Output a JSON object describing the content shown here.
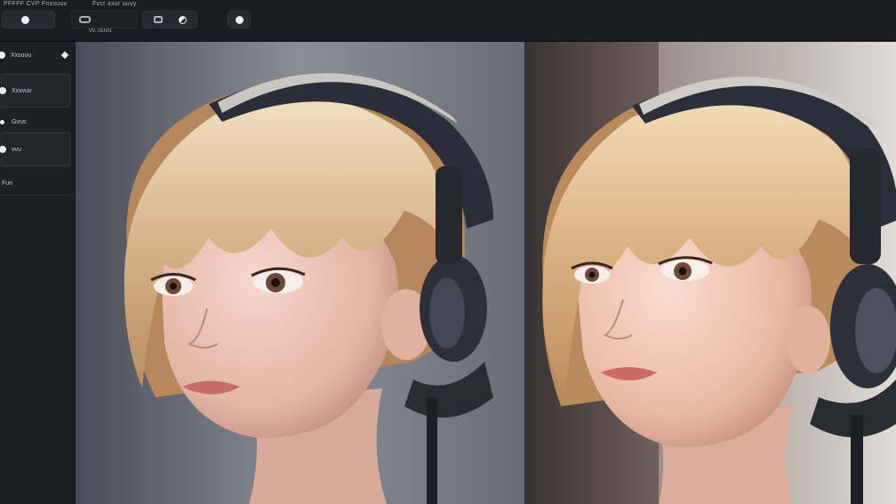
{
  "toolbar": {
    "title": "PFFFF CVP Fnxsuuv",
    "menu_label": "Fvcr xxur uuvy",
    "caption": "vv..uuvu"
  },
  "sidebar": {
    "items": [
      {
        "label": "Xxsuvu"
      },
      {
        "label": "Xxxvuv"
      },
      {
        "label": "Gvus"
      },
      {
        "label": "vvu"
      },
      {
        "label": "Fun"
      }
    ]
  },
  "canvases": [
    {
      "name": "render-original"
    },
    {
      "name": "render-refined"
    }
  ]
}
